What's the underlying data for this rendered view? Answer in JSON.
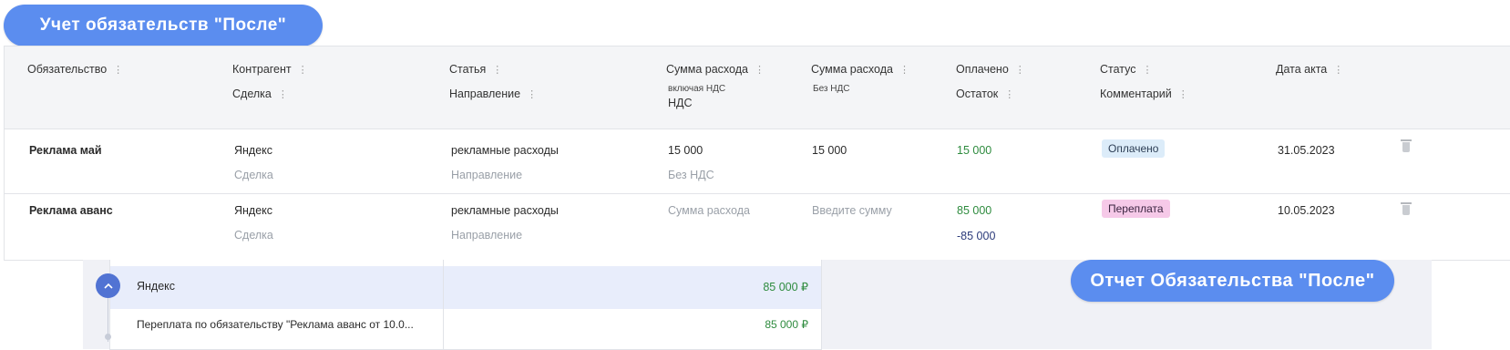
{
  "title_pill": "Учет обязательств \"После\"",
  "report_pill": "Отчет Обязательства \"После\"",
  "columns": {
    "obligation": "Обязательство",
    "counterparty": "Контрагент",
    "deal": "Сделка",
    "article": "Статья",
    "direction": "Направление",
    "expense_with_vat": "Сумма расхода",
    "expense_with_vat_sub": "включая НДС",
    "vat": "НДС",
    "expense_no_vat": "Сумма расхода",
    "expense_no_vat_sub": "Без НДС",
    "paid": "Оплачено",
    "remainder": "Остаток",
    "status": "Статус",
    "comment": "Комментарий",
    "act_date": "Дата акта",
    "menu_icon": "vertical-dots-icon"
  },
  "rows": [
    {
      "obligation": "Реклама май",
      "counterparty": "Яндекс",
      "deal": "Сделка",
      "article": "рекламные расходы",
      "direction": "Направление",
      "expense_with_vat": "15 000",
      "vat": "Без НДС",
      "expense_no_vat": "15 000",
      "paid": "15 000",
      "remainder": "",
      "status": "Оплачено",
      "act_date": "31.05.2023"
    },
    {
      "obligation": "Реклама аванс",
      "counterparty": "Яндекс",
      "deal": "Сделка",
      "article": "рекламные расходы",
      "direction": "Направление",
      "expense_with_vat": "Сумма расхода",
      "vat": "",
      "expense_no_vat": "Введите сумму",
      "paid": "85 000",
      "remainder": "-85 000",
      "status": "Переплата",
      "act_date": "10.05.2023"
    }
  ],
  "report": {
    "group_name": "Яндекс",
    "group_amount": "85 000 ₽",
    "item_name": "Переплата по обязательству \"Реклама аванс от 10.0...",
    "item_amount": "85 000 ₽",
    "toggle_icon": "chevron-up-icon"
  },
  "colors": {
    "accent": "#5b8def",
    "paid_badge": "#dcecf9",
    "overpay_badge": "#f6c9e8",
    "positive": "#2e8b3e",
    "negative": "#2b3a7a"
  }
}
